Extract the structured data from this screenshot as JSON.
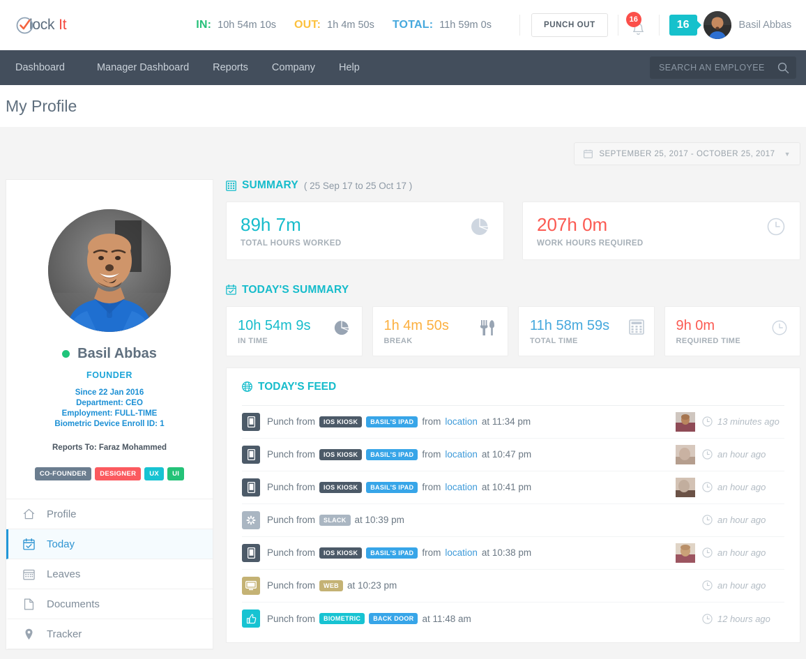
{
  "header": {
    "logo": {
      "mark": "clock-check-icon",
      "text_primary": "lock",
      "text_accent": "It"
    },
    "stats": [
      {
        "label": "IN:",
        "value": "10h 54m 10s",
        "color": "#27c07a"
      },
      {
        "label": "OUT:",
        "value": "1h 4m 50s",
        "color": "#fcc13d"
      },
      {
        "label": "TOTAL:",
        "value": "11h 59m 0s",
        "color": "#45a8dd"
      }
    ],
    "punch_button": "PUNCH OUT",
    "notification_count": "16",
    "notification_icon": "bell-icon",
    "team_count": "16",
    "user_name": "Basil Abbas"
  },
  "nav": {
    "items": [
      {
        "label": "Dashboard"
      },
      {
        "label": "Manager Dashboard"
      },
      {
        "label": "Reports"
      },
      {
        "label": "Company"
      },
      {
        "label": "Help"
      }
    ],
    "search_placeholder": "SEARCH AN EMPLOYEE",
    "search_value": "",
    "search_icon": "search-icon"
  },
  "page": {
    "title": "My Profile"
  },
  "daterange": {
    "icon": "calendar-icon",
    "label": "SEPTEMBER 25, 2017 - OCTOBER 25, 2017",
    "caret": "chevron-down-icon"
  },
  "profile": {
    "avatar": "user-photo",
    "status": "online",
    "name": "Basil Abbas",
    "role": "FOUNDER",
    "meta": [
      "Since 22 Jan 2016",
      "Department: CEO",
      "Employment: FULL-TIME",
      "Biometric Device Enroll ID: 1"
    ],
    "reports_to": "Reports To: Faraz Mohammed",
    "tags": [
      {
        "label": "CO-FOUNDER",
        "color": "#6b7d8f"
      },
      {
        "label": "DESIGNER",
        "color": "#fb5a5f"
      },
      {
        "label": "UX",
        "color": "#17c3d2"
      },
      {
        "label": "UI",
        "color": "#24c278"
      }
    ],
    "menu": [
      {
        "label": "Profile",
        "icon": "home-icon",
        "active": false
      },
      {
        "label": "Today",
        "icon": "calendar-check-icon",
        "active": true
      },
      {
        "label": "Leaves",
        "icon": "calendar-grid-icon",
        "active": false
      },
      {
        "label": "Documents",
        "icon": "file-icon",
        "active": false
      },
      {
        "label": "Tracker",
        "icon": "map-pin-icon",
        "active": false
      }
    ]
  },
  "summary": {
    "icon": "grid-calc-icon",
    "title": "SUMMARY",
    "subtitle": "( 25 Sep 17 to 25 Oct 17 )",
    "cards": [
      {
        "value": "89h 7m",
        "label": "TOTAL HOURS WORKED",
        "color": "#16bccb",
        "icon": "pie-chart-icon"
      },
      {
        "value": "207h 0m",
        "label": "WORK HOURS REQUIRED",
        "color": "#fb5a52",
        "icon": "clock-icon"
      }
    ]
  },
  "today_summary": {
    "icon": "calendar-check-icon",
    "title": "TODAY'S SUMMARY",
    "cards": [
      {
        "value": "10h 54m 9s",
        "label": "IN TIME",
        "color": "#16bccb",
        "icon": "pie-chart-icon"
      },
      {
        "value": "1h 4m 50s",
        "label": "BREAK",
        "color": "#fcb040",
        "icon": "cutlery-icon"
      },
      {
        "value": "11h 58m 59s",
        "label": "TOTAL TIME",
        "color": "#45a8dd",
        "icon": "calculator-icon"
      },
      {
        "value": "9h 0m",
        "label": "REQUIRED TIME",
        "color": "#fb5a52",
        "icon": "clock-icon"
      }
    ]
  },
  "feed": {
    "icon": "globe-icon",
    "title": "TODAY'S FEED",
    "rows": [
      {
        "icon": "mobile-icon",
        "icon_bg": "#4c5a68",
        "prefix": "Punch from",
        "pills": [
          {
            "label": "IOS KIOSK",
            "color": "#4c5a68"
          },
          {
            "label": "BASIL'S IPAD",
            "color": "#37a5e8"
          }
        ],
        "mid": "from",
        "link": "location",
        "suffix": "at 11:34 pm",
        "thumb": true,
        "thumb_color": "#8f4b56",
        "time": "13 minutes ago"
      },
      {
        "icon": "mobile-icon",
        "icon_bg": "#4c5a68",
        "prefix": "Punch from",
        "pills": [
          {
            "label": "IOS KIOSK",
            "color": "#4c5a68"
          },
          {
            "label": "BASIL'S IPAD",
            "color": "#37a5e8"
          }
        ],
        "mid": "from",
        "link": "location",
        "suffix": "at 10:47 pm",
        "thumb": true,
        "thumb_color": "#cdb7ab",
        "time": "an hour ago"
      },
      {
        "icon": "mobile-icon",
        "icon_bg": "#4c5a68",
        "prefix": "Punch from",
        "pills": [
          {
            "label": "IOS KIOSK",
            "color": "#4c5a68"
          },
          {
            "label": "BASIL'S IPAD",
            "color": "#37a5e8"
          }
        ],
        "mid": "from",
        "link": "location",
        "suffix": "at 10:41 pm",
        "thumb": true,
        "thumb_color": "#bfa394",
        "time": "an hour ago"
      },
      {
        "icon": "slack-icon",
        "icon_bg": "#aab6c2",
        "prefix": "Punch from",
        "pills": [
          {
            "label": "SLACK",
            "color": "#aab6c2"
          }
        ],
        "mid": "",
        "link": "",
        "suffix": "at 10:39 pm",
        "thumb": false,
        "thumb_color": "",
        "time": "an hour ago"
      },
      {
        "icon": "mobile-icon",
        "icon_bg": "#4c5a68",
        "prefix": "Punch from",
        "pills": [
          {
            "label": "IOS KIOSK",
            "color": "#4c5a68"
          },
          {
            "label": "BASIL'S IPAD",
            "color": "#37a5e8"
          }
        ],
        "mid": "from",
        "link": "location",
        "suffix": "at 10:38 pm",
        "thumb": true,
        "thumb_color": "#9c5560",
        "time": "an hour ago"
      },
      {
        "icon": "desktop-icon",
        "icon_bg": "#c4b274",
        "prefix": "Punch from",
        "pills": [
          {
            "label": "WEB",
            "color": "#c4b274"
          }
        ],
        "mid": "",
        "link": "",
        "suffix": "at 10:23 pm",
        "thumb": false,
        "thumb_color": "",
        "time": "an hour ago"
      },
      {
        "icon": "thumbs-up-icon",
        "icon_bg": "#17c3d2",
        "prefix": "Punch from",
        "pills": [
          {
            "label": "BIOMETRIC",
            "color": "#17c3d2"
          },
          {
            "label": "BACK DOOR",
            "color": "#37a5e8"
          }
        ],
        "mid": "",
        "link": "",
        "suffix": "at 11:48 am",
        "thumb": false,
        "thumb_color": "",
        "time": "12 hours ago"
      }
    ]
  }
}
